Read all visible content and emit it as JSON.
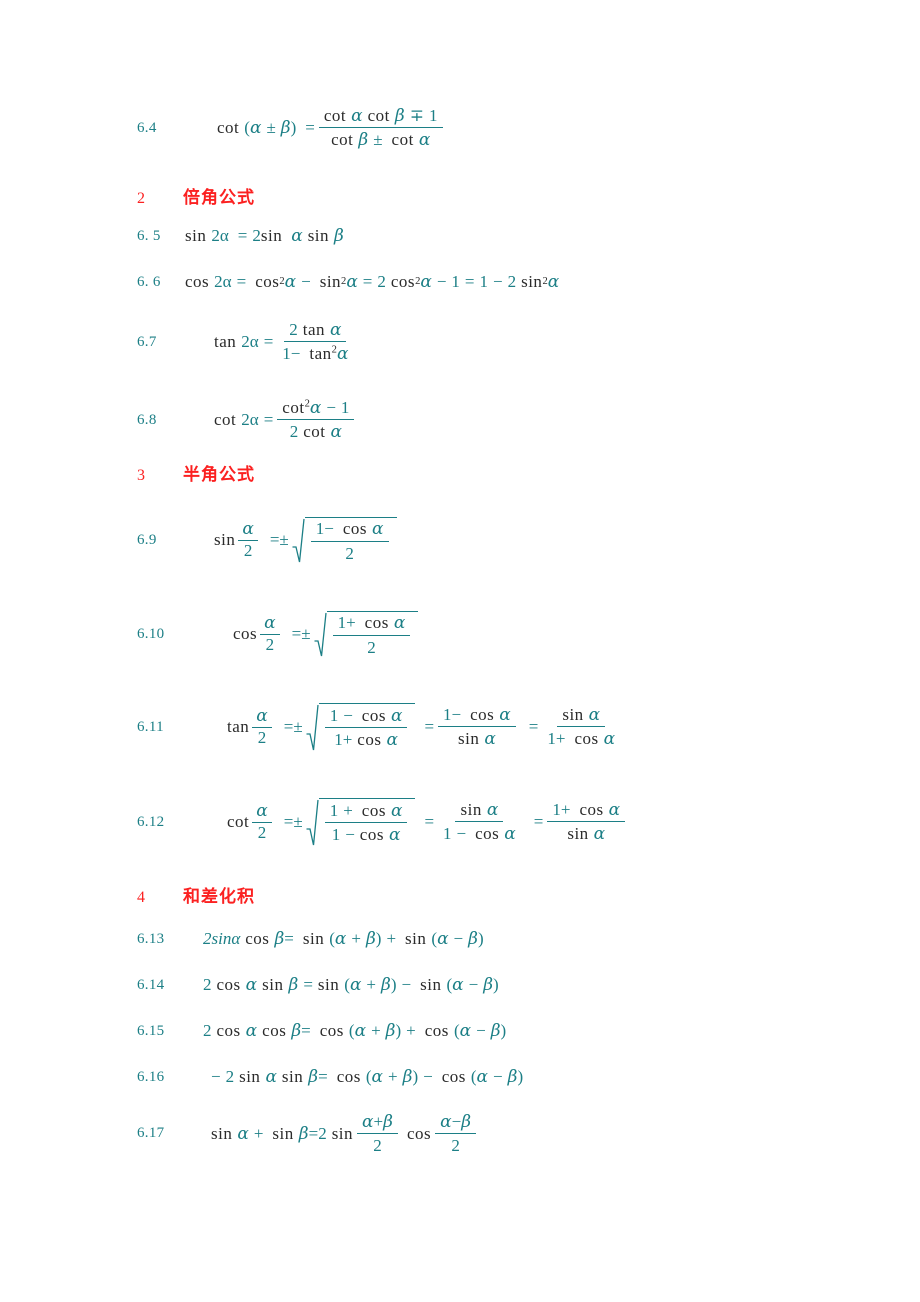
{
  "document": {
    "kind": "math-formula-sheet",
    "language": "zh-CN",
    "background": "#ffffff",
    "colors": {
      "formula_number": "#1c7f86",
      "section_heading": "#fb2121",
      "math_symbol": "#1c7f86",
      "function_name": "#2b2b2b"
    }
  },
  "sections": [
    {
      "number": "2",
      "title": "倍角公式"
    },
    {
      "number": "3",
      "title": "半角公式"
    },
    {
      "number": "4",
      "title": "和差化积"
    }
  ],
  "formulas": {
    "f6_4": {
      "number": "6.4",
      "text": "cot (α ± β) = (cot α cot β ∓ 1) / (cot β ± cot α)",
      "lhs_fn": "cot",
      "paren_open": "(",
      "alpha": "α",
      "pm": "±",
      "beta": "β",
      "paren_close": ")",
      "eq": "=",
      "num_fn1": "cot",
      "num_fn2": "cot",
      "num_mp": "∓",
      "num_one": "1",
      "den_fn1": "cot",
      "den_pm": "±",
      "den_fn2": "cot"
    },
    "f6_5": {
      "number": "6. 5",
      "text": "sin 2α = 2 sin α sin β",
      "fn1": "sin",
      "two_a": "2α",
      "eq": "=",
      "two": "2",
      "fn2": "sin",
      "alpha": "α",
      "fn3": "sin",
      "beta": "β"
    },
    "f6_6": {
      "number": "6. 6",
      "text": "cos 2α = cos²α − sin²α = 2 cos²α − 1 = 1 − 2 sin²α",
      "fn_cos": "cos",
      "fn_sin": "sin",
      "two_a": "2α",
      "eq": "=",
      "minus": "−",
      "sup2": "2",
      "alpha": "α",
      "two": "2",
      "one": "1"
    },
    "f6_7": {
      "number": "6.7",
      "text": "tan 2α = 2 tan α / (1 − tan²α)",
      "fn": "tan",
      "two_a": "2α",
      "eq": "=",
      "num_two": "2",
      "num_fn": "tan",
      "num_alpha": "α",
      "den_one": "1",
      "den_minus": "−",
      "den_fn": "tan",
      "den_sup": "2",
      "den_alpha": "α"
    },
    "f6_8": {
      "number": "6.8",
      "text": "cot 2α = (cot²α − 1) / (2 cot α)",
      "fn": "cot",
      "two_a": "2α",
      "eq": "=",
      "num_fn": "cot",
      "num_sup": "2",
      "num_alpha": "α",
      "num_minus": "−",
      "num_one": "1",
      "den_two": "2",
      "den_fn": "cot",
      "den_alpha": "α"
    },
    "f6_9": {
      "number": "6.9",
      "text": "sin α/2 = ± √((1 − cos α)/2)",
      "fn": "sin",
      "alpha": "α",
      "two": "2",
      "eqpm": "=±",
      "num_one": "1",
      "num_op": "−",
      "num_fn": "cos",
      "num_alpha": "α",
      "den": "2"
    },
    "f6_10": {
      "number": "6.10",
      "text": "cos α/2 = ± √((1 + cos α)/2)",
      "fn": "cos",
      "alpha": "α",
      "two": "2",
      "eqpm": "=±",
      "num_one": "1",
      "num_op": "+",
      "num_fn": "cos",
      "num_alpha": "α",
      "den": "2"
    },
    "f6_11": {
      "number": "6.11",
      "text": "tan α/2 = ± √((1 − cos α)/(1 + cos α)) = (1 − cos α)/sin α = sin α/(1 + cos α)",
      "fn": "tan",
      "alpha": "α",
      "two": "2",
      "eqpm": "=±",
      "r_num_one": "1",
      "r_num_op": "−",
      "r_num_fn": "cos",
      "r_den_one": "1",
      "r_den_op": "+",
      "r_den_fn": "cos",
      "eq": "=",
      "m_num_one": "1",
      "m_num_op": "−",
      "m_num_fn": "cos",
      "m_den_fn": "sin",
      "l_num_fn": "sin",
      "l_den_one": "1",
      "l_den_op": "+",
      "l_den_fn": "cos"
    },
    "f6_12": {
      "number": "6.12",
      "text": "cot α/2 = ± √((1 + cos α)/(1 − cos α)) = sin α/(1 − cos α) = (1 + cos α)/sin α",
      "fn": "cot",
      "alpha": "α",
      "two": "2",
      "eqpm": "=±",
      "r_num_one": "1",
      "r_num_op": "+",
      "r_num_fn": "cos",
      "r_den_one": "1",
      "r_den_op": "−",
      "r_den_fn": "cos",
      "eq": "=",
      "m_num_fn": "sin",
      "m_den_one": "1",
      "m_den_op": "−",
      "m_den_fn": "cos",
      "l_num_one": "1",
      "l_num_op": "+",
      "l_num_fn": "cos",
      "l_den_fn": "sin"
    },
    "f6_13": {
      "number": "6.13",
      "text": "2sinα cos β = sin (α + β) + sin (α − β)",
      "lead": "2sinα",
      "fn_cos": "cos",
      "beta": "β",
      "eq": "=",
      "fn_sin": "sin",
      "alpha": "α",
      "plus": "+",
      "minus": "−",
      "op_mid": "+"
    },
    "f6_14": {
      "number": "6.14",
      "text": "2 cos α sin β = sin (α + β) − sin (α − β)",
      "two": "2",
      "fn_cos": "cos",
      "alpha": "α",
      "fn_sin": "sin",
      "beta": "β",
      "eq": "=",
      "plus": "+",
      "minus": "−",
      "op_mid": "−"
    },
    "f6_15": {
      "number": "6.15",
      "text": "2 cos α cos β = cos (α + β) + cos (α − β)",
      "two": "2",
      "fn_cos": "cos",
      "alpha": "α",
      "beta": "β",
      "eq": "=",
      "plus": "+",
      "minus": "−",
      "op_mid": "+"
    },
    "f6_16": {
      "number": "6.16",
      "text": "− 2 sin α sin β = cos (α + β) − cos (α − β)",
      "neg": "−",
      "two": "2",
      "fn_sin": "sin",
      "fn_cos": "cos",
      "alpha": "α",
      "beta": "β",
      "eq": "=",
      "plus": "+",
      "minus": "−",
      "op_mid": "−"
    },
    "f6_17": {
      "number": "6.17",
      "text": "sin α + sin β = 2 sin ((α + β)/2) cos ((α − β)/2)",
      "fn_sin": "sin",
      "alpha": "α",
      "plus": "+",
      "beta": "β",
      "eq": "=",
      "two": "2",
      "fn_cos": "cos",
      "num1_a": "α",
      "num1_op": "+",
      "num1_b": "β",
      "den1": "2",
      "num2_a": "α",
      "num2_op": "−",
      "num2_b": "β",
      "den2": "2"
    }
  }
}
